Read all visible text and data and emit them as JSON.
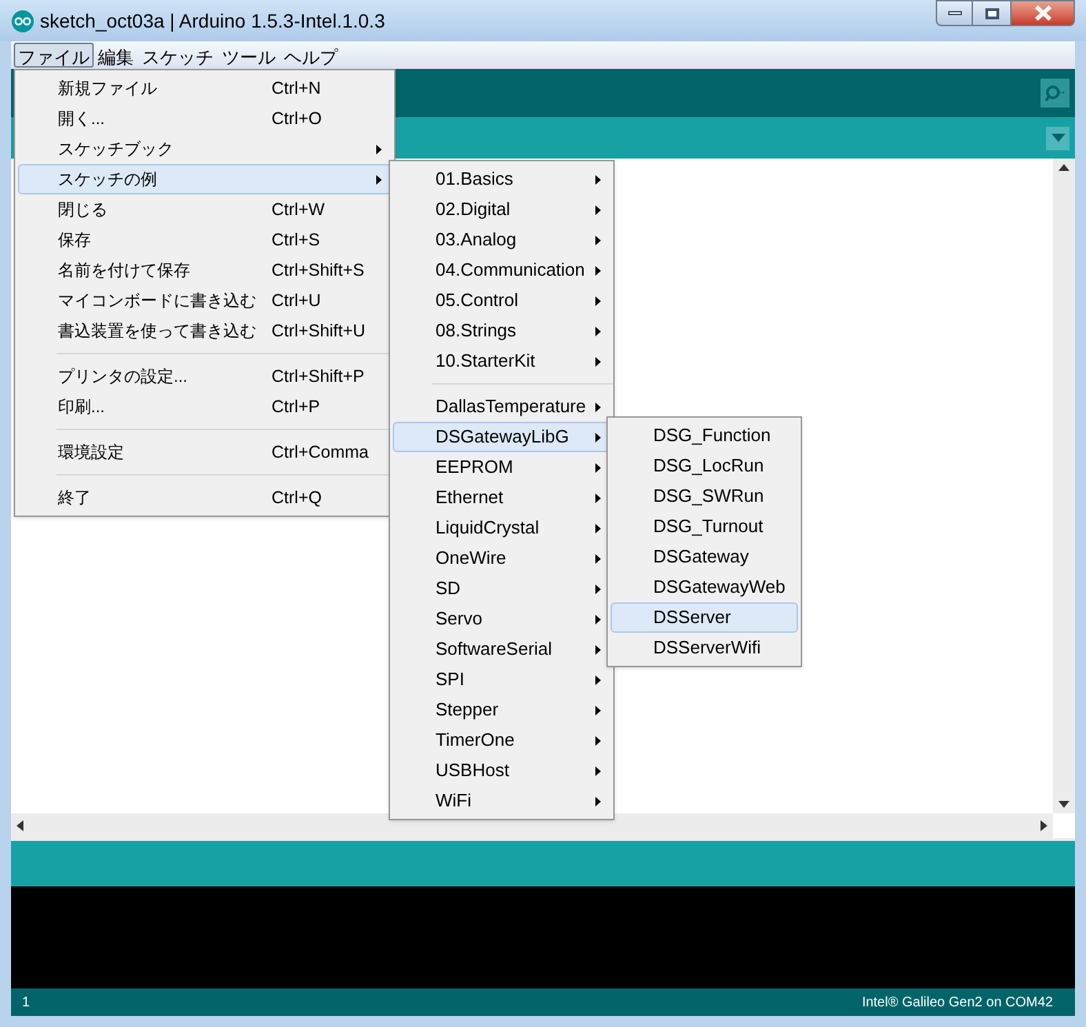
{
  "window": {
    "title": "sketch_oct03a | Arduino 1.5.3-Intel.1.0.3"
  },
  "menu_bar": [
    {
      "label": "ファイル",
      "selected": true
    },
    {
      "label": "編集",
      "selected": false
    },
    {
      "label": "スケッチ",
      "selected": false
    },
    {
      "label": "ツール",
      "selected": false
    },
    {
      "label": "ヘルプ",
      "selected": false
    }
  ],
  "file_menu": [
    {
      "kind": "item",
      "label": "新規ファイル",
      "shortcut": "Ctrl+N",
      "selected": false
    },
    {
      "kind": "item",
      "label": "開く...",
      "shortcut": "Ctrl+O",
      "selected": false
    },
    {
      "kind": "submenu",
      "label": "スケッチブック",
      "selected": false
    },
    {
      "kind": "submenu",
      "label": "スケッチの例",
      "selected": true
    },
    {
      "kind": "item",
      "label": "閉じる",
      "shortcut": "Ctrl+W",
      "selected": false
    },
    {
      "kind": "item",
      "label": "保存",
      "shortcut": "Ctrl+S",
      "selected": false
    },
    {
      "kind": "item",
      "label": "名前を付けて保存",
      "shortcut": "Ctrl+Shift+S",
      "selected": false
    },
    {
      "kind": "item",
      "label": "マイコンボードに書き込む",
      "shortcut": "Ctrl+U",
      "selected": false
    },
    {
      "kind": "item",
      "label": "書込装置を使って書き込む",
      "shortcut": "Ctrl+Shift+U",
      "selected": false
    },
    {
      "kind": "separator"
    },
    {
      "kind": "item",
      "label": "プリンタの設定...",
      "shortcut": "Ctrl+Shift+P",
      "selected": false
    },
    {
      "kind": "item",
      "label": "印刷...",
      "shortcut": "Ctrl+P",
      "selected": false
    },
    {
      "kind": "separator"
    },
    {
      "kind": "item",
      "label": "環境設定",
      "shortcut": "Ctrl+Comma",
      "selected": false
    },
    {
      "kind": "separator"
    },
    {
      "kind": "item",
      "label": "終了",
      "shortcut": "Ctrl+Q",
      "selected": false
    }
  ],
  "examples_menu": [
    {
      "kind": "submenu",
      "label": "01.Basics",
      "selected": false
    },
    {
      "kind": "submenu",
      "label": "02.Digital",
      "selected": false
    },
    {
      "kind": "submenu",
      "label": "03.Analog",
      "selected": false
    },
    {
      "kind": "submenu",
      "label": "04.Communication",
      "selected": false
    },
    {
      "kind": "submenu",
      "label": "05.Control",
      "selected": false
    },
    {
      "kind": "submenu",
      "label": "08.Strings",
      "selected": false
    },
    {
      "kind": "submenu",
      "label": "10.StarterKit",
      "selected": false
    },
    {
      "kind": "separator"
    },
    {
      "kind": "submenu",
      "label": "DallasTemperature",
      "selected": false
    },
    {
      "kind": "submenu",
      "label": "DSGatewayLibG",
      "selected": true
    },
    {
      "kind": "submenu",
      "label": "EEPROM",
      "selected": false
    },
    {
      "kind": "submenu",
      "label": "Ethernet",
      "selected": false
    },
    {
      "kind": "submenu",
      "label": "LiquidCrystal",
      "selected": false
    },
    {
      "kind": "submenu",
      "label": "OneWire",
      "selected": false
    },
    {
      "kind": "submenu",
      "label": "SD",
      "selected": false
    },
    {
      "kind": "submenu",
      "label": "Servo",
      "selected": false
    },
    {
      "kind": "submenu",
      "label": "SoftwareSerial",
      "selected": false
    },
    {
      "kind": "submenu",
      "label": "SPI",
      "selected": false
    },
    {
      "kind": "submenu",
      "label": "Stepper",
      "selected": false
    },
    {
      "kind": "submenu",
      "label": "TimerOne",
      "selected": false
    },
    {
      "kind": "submenu",
      "label": "USBHost",
      "selected": false
    },
    {
      "kind": "submenu",
      "label": "WiFi",
      "selected": false
    }
  ],
  "library_menu": [
    {
      "label": "DSG_Function",
      "selected": false
    },
    {
      "label": "DSG_LocRun",
      "selected": false
    },
    {
      "label": "DSG_SWRun",
      "selected": false
    },
    {
      "label": "DSG_Turnout",
      "selected": false
    },
    {
      "label": "DSGateway",
      "selected": false
    },
    {
      "label": "DSGatewayWeb",
      "selected": false
    },
    {
      "label": "DSServer",
      "selected": true
    },
    {
      "label": "DSServerWifi",
      "selected": false
    }
  ],
  "status_bar": {
    "line": "1",
    "board": "Intel® Galileo Gen2 on COM42"
  }
}
